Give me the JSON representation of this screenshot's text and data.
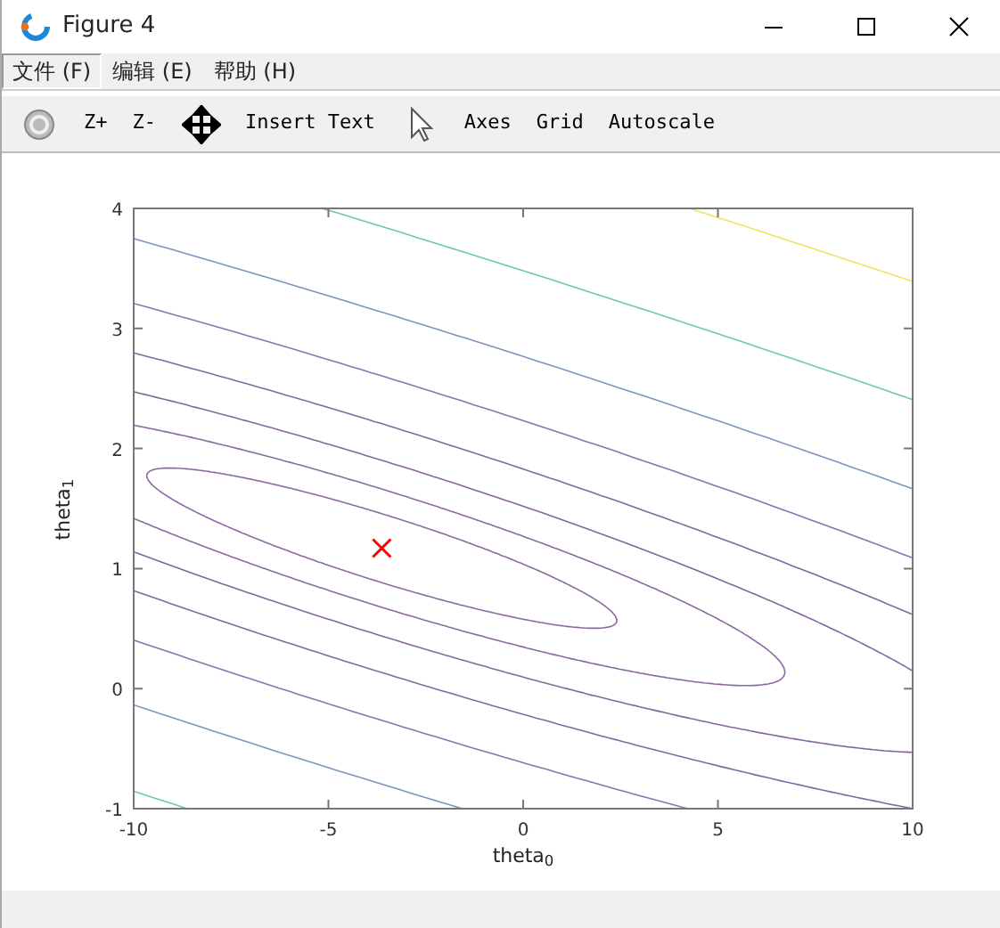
{
  "window": {
    "title": "Figure 4"
  },
  "menu": [
    {
      "label": "文件 (F)",
      "selected": true
    },
    {
      "label": "编辑 (E)",
      "selected": false
    },
    {
      "label": "帮助 (H)",
      "selected": false
    }
  ],
  "toolbar": [
    {
      "kind": "rotate"
    },
    {
      "kind": "text",
      "label": "Z+"
    },
    {
      "kind": "text",
      "label": "Z-"
    },
    {
      "kind": "pan"
    },
    {
      "kind": "text",
      "label": "Insert Text"
    },
    {
      "kind": "pointer"
    },
    {
      "kind": "text",
      "label": "Axes"
    },
    {
      "kind": "text",
      "label": "Grid"
    },
    {
      "kind": "text",
      "label": "Autoscale"
    }
  ],
  "figure": {
    "chart_data": {
      "type": "scatter",
      "xlabel": "theta$_{0}$",
      "ylabel": "theta$_{1}$",
      "xlim": [
        -10,
        10
      ],
      "ylim": [
        -1,
        4
      ],
      "xticks": [
        {
          "value": -10,
          "label": "-10"
        },
        {
          "value": -5,
          "label": "-5"
        },
        {
          "value": 0,
          "label": "0"
        },
        {
          "value": 5,
          "label": "5"
        },
        {
          "value": 10,
          "label": "10"
        }
      ],
      "yticks": [
        {
          "value": -1,
          "label": "-1"
        },
        {
          "value": 0,
          "label": "0"
        },
        {
          "value": 1,
          "label": "1"
        },
        {
          "value": 2,
          "label": "2"
        },
        {
          "value": 3,
          "label": "3"
        },
        {
          "value": 4,
          "label": "4"
        }
      ],
      "x": [
        -3.63
      ],
      "series": [
        {
          "color": "#ff0000",
          "values": [
            1.17
          ]
        }
      ]
    }
  }
}
